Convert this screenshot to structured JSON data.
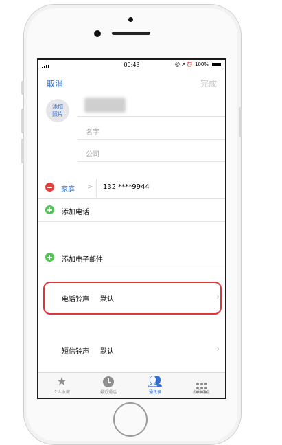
{
  "status_bar": {
    "time": "09:43",
    "battery": "100%"
  },
  "nav": {
    "cancel": "取消",
    "done": "完成"
  },
  "avatar": {
    "line1": "添加",
    "line2": "照片"
  },
  "fields": {
    "first_name_placeholder": "名字",
    "company_placeholder": "公司"
  },
  "phone": {
    "label": "家庭",
    "number": "132 ****9944"
  },
  "actions": {
    "add_phone": "添加电话",
    "add_email": "添加电子邮件"
  },
  "ringtone": {
    "label": "电话铃声",
    "value": "默认"
  },
  "sms_tone": {
    "label": "短信铃声",
    "value": "默认"
  },
  "tabs": [
    {
      "label": "个人收藏",
      "icon": "star-icon"
    },
    {
      "label": "最近通话",
      "icon": "clock-icon"
    },
    {
      "label": "通讯录",
      "icon": "contacts-icon"
    },
    {
      "label": "拨号键盘",
      "icon": "keypad-icon"
    }
  ],
  "colors": {
    "accent": "#2f6fd1",
    "highlight": "#e0353a",
    "delete": "#e2403c",
    "add": "#4fc653"
  }
}
